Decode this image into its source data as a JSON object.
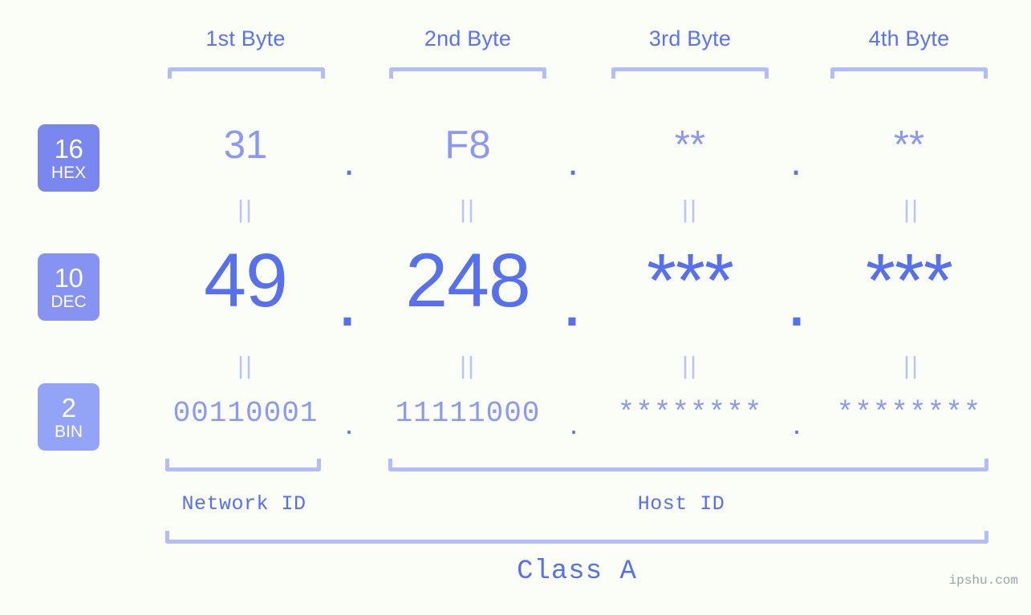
{
  "theme": {
    "background": "#fbfdf7",
    "primary_blue": "#5770ee",
    "light_blue": "#8b99f4",
    "bracket_blue": "#b3bdfb",
    "badge_hex": "#7a87ee",
    "badge_dec": "#8793f2",
    "badge_bin": "#93a4f6"
  },
  "headers": {
    "bytes": [
      {
        "label": "1st Byte"
      },
      {
        "label": "2nd Byte"
      },
      {
        "label": "3rd Byte"
      },
      {
        "label": "4th Byte"
      }
    ]
  },
  "bases": [
    {
      "num": "16",
      "name": "HEX"
    },
    {
      "num": "10",
      "name": "DEC"
    },
    {
      "num": "2",
      "name": "BIN"
    }
  ],
  "rows": {
    "hex": {
      "base_num": "16",
      "base_name": "HEX",
      "values": [
        "31",
        "F8",
        "**",
        "**"
      ],
      "separator": "."
    },
    "dec": {
      "base_num": "10",
      "base_name": "DEC",
      "values": [
        "49",
        "248",
        "***",
        "***"
      ],
      "separator": "."
    },
    "bin": {
      "base_num": "2",
      "base_name": "BIN",
      "values": [
        "00110001",
        "11111000",
        "********",
        "********"
      ],
      "separator": "."
    }
  },
  "equality_marks": {
    "glyph": "||",
    "count_per_gap": 4
  },
  "segments": {
    "network_id": "Network ID",
    "host_id": "Host ID",
    "class": "Class A"
  },
  "footer": {
    "watermark": "ipshu.com"
  }
}
